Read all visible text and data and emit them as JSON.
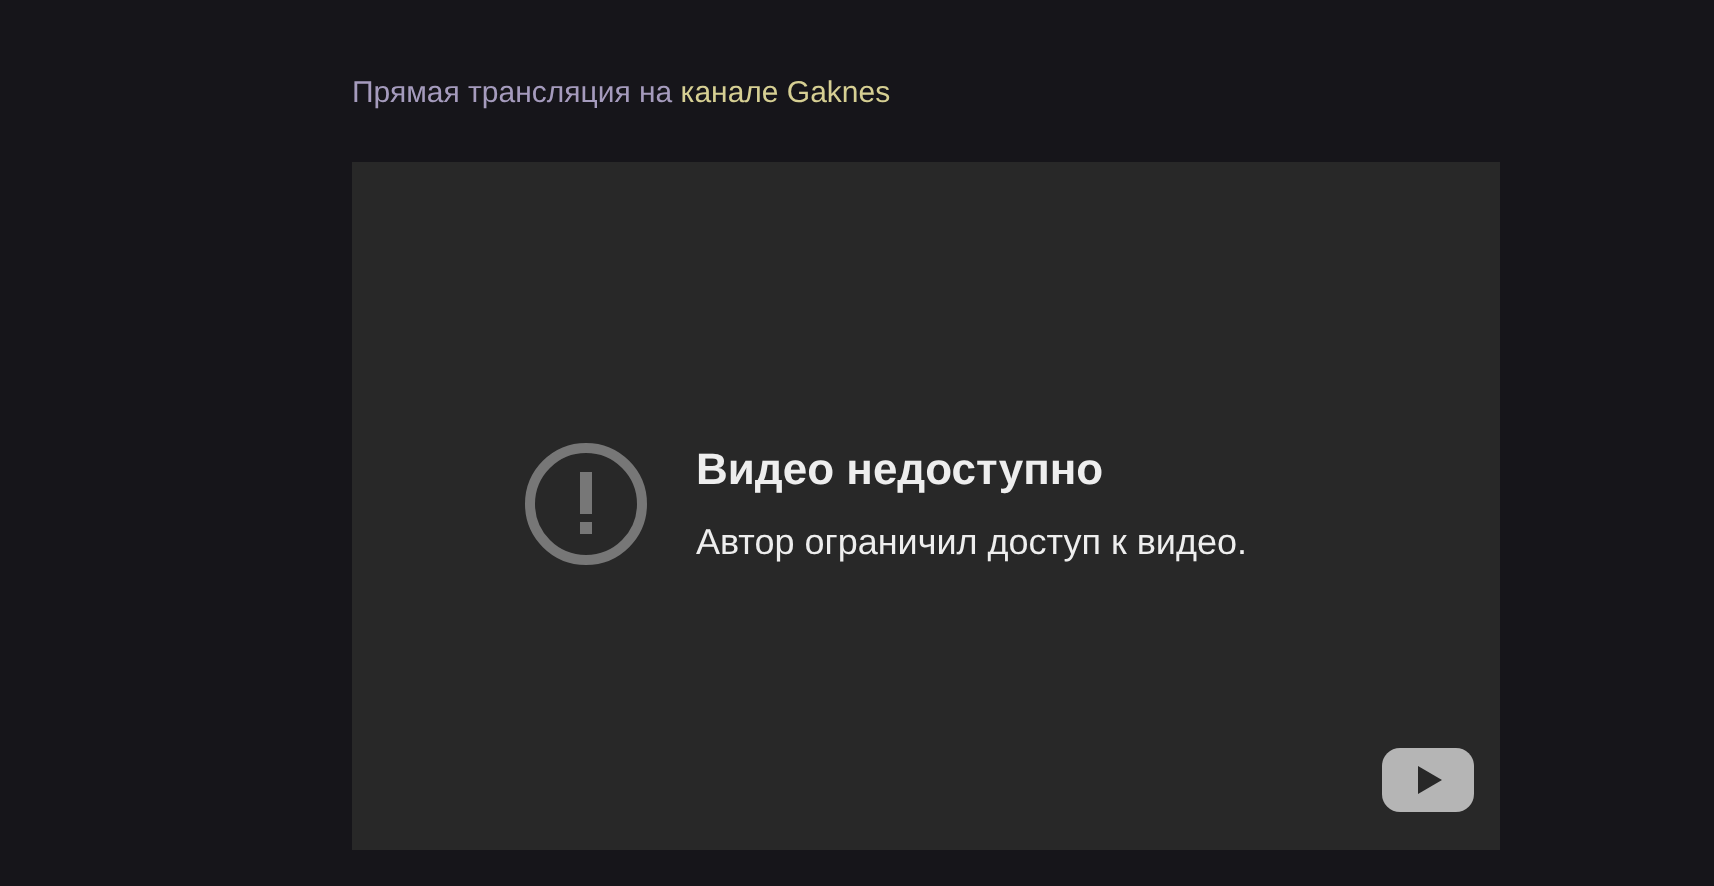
{
  "heading": {
    "text": "Прямая трансляция на ",
    "link": "канале Gaknes"
  },
  "player": {
    "title": "Видео недоступно",
    "message": "Автор ограничил доступ к видео."
  }
}
